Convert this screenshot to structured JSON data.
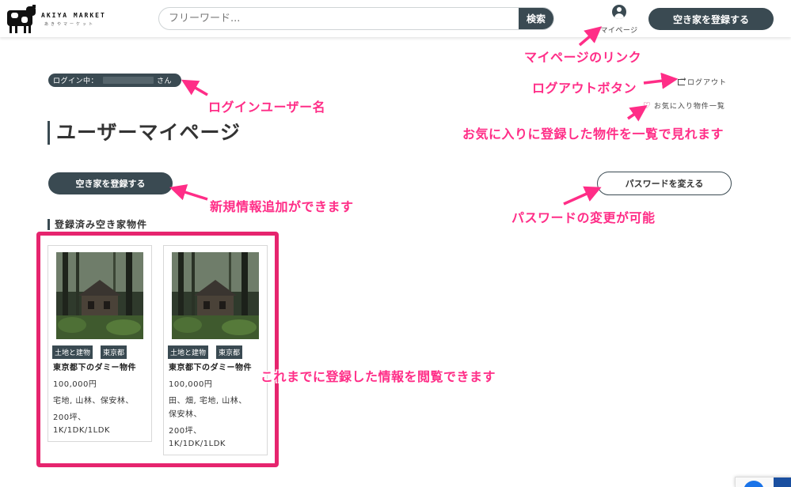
{
  "header": {
    "logo_text": "AKIYA MARKET",
    "logo_subtext": "あきやマーケット",
    "search_placeholder": "フリーワード...",
    "search_button": "検索",
    "mypage_label": "マイページ",
    "register_button": "空き家を登録する"
  },
  "account": {
    "login_prefix": "ログイン中：",
    "login_suffix": "さん",
    "logout_label": "ログアウト",
    "favorites_label": "お気に入り物件一覧"
  },
  "page": {
    "title": "ユーザーマイページ",
    "register_button": "空き家を登録する",
    "password_button": "パスワードを変える",
    "section_title": "登録済み空き家物件"
  },
  "listings": [
    {
      "tags": [
        "土地と建物",
        "東京都"
      ],
      "name": "東京都下のダミー物件",
      "price": "100,000円",
      "details": [
        "宅地, 山林、保安林、",
        "200坪、",
        "1K/1DK/1LDK"
      ]
    },
    {
      "tags": [
        "土地と建物",
        "東京都"
      ],
      "name": "東京都下のダミー物件",
      "price": "100,000円",
      "details": [
        "田、畑, 宅地, 山林、",
        "保安林、",
        "200坪、",
        "1K/1DK/1LDK"
      ]
    }
  ],
  "annotations": {
    "mypage_link": "マイページのリンク",
    "logout_button": "ログアウトボタン",
    "login_user": "ログインユーザー名",
    "favorites": "お気に入りに登録した物件を一覧で見れます",
    "add_new": "新規情報追加ができます",
    "password_change": "パスワードの変更が可能",
    "view_registered": "これまでに登録した情報を閲覧できます"
  },
  "colors": {
    "primary": "#3a4a52",
    "annotation": "#ff2d87",
    "highlight_frame": "#e6246e"
  }
}
